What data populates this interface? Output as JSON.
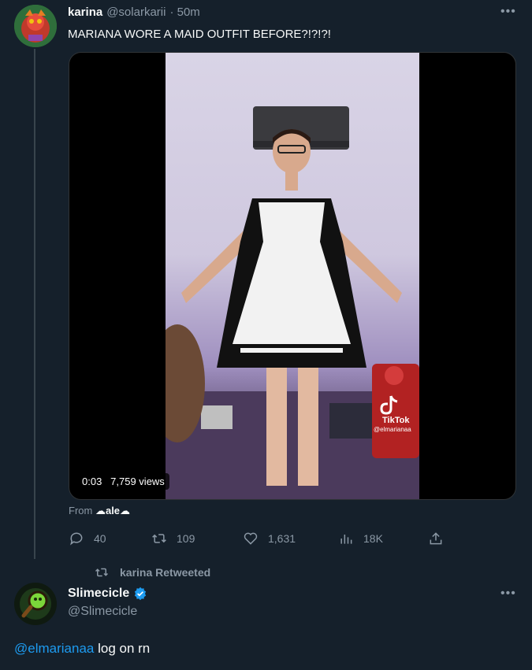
{
  "tweet1": {
    "display_name": "karina",
    "handle": "@solarkarii",
    "time": "· 50m",
    "text": "MARIANA WORE A MAID OUTFIT BEFORE?!?!?!",
    "video": {
      "time": "0:03",
      "views": "7,759 views",
      "tiktok_label": "TikTok",
      "tiktok_handle": "@elmarianaa"
    },
    "source_label": "From",
    "source_name": "☁ale☁",
    "stats": {
      "replies": "40",
      "retweets": "109",
      "likes": "1,631",
      "views": "18K"
    }
  },
  "retweet_notice": "karina Retweeted",
  "tweet2": {
    "display_name": "Slimecicle",
    "handle": "@Slimecicle",
    "mention": "@elmarianaa",
    "text_rest": " log on rn"
  },
  "colors": {
    "background": "#15202b",
    "text": "#f7f9f9",
    "muted": "#8b98a5",
    "accent": "#1d9bf0"
  }
}
